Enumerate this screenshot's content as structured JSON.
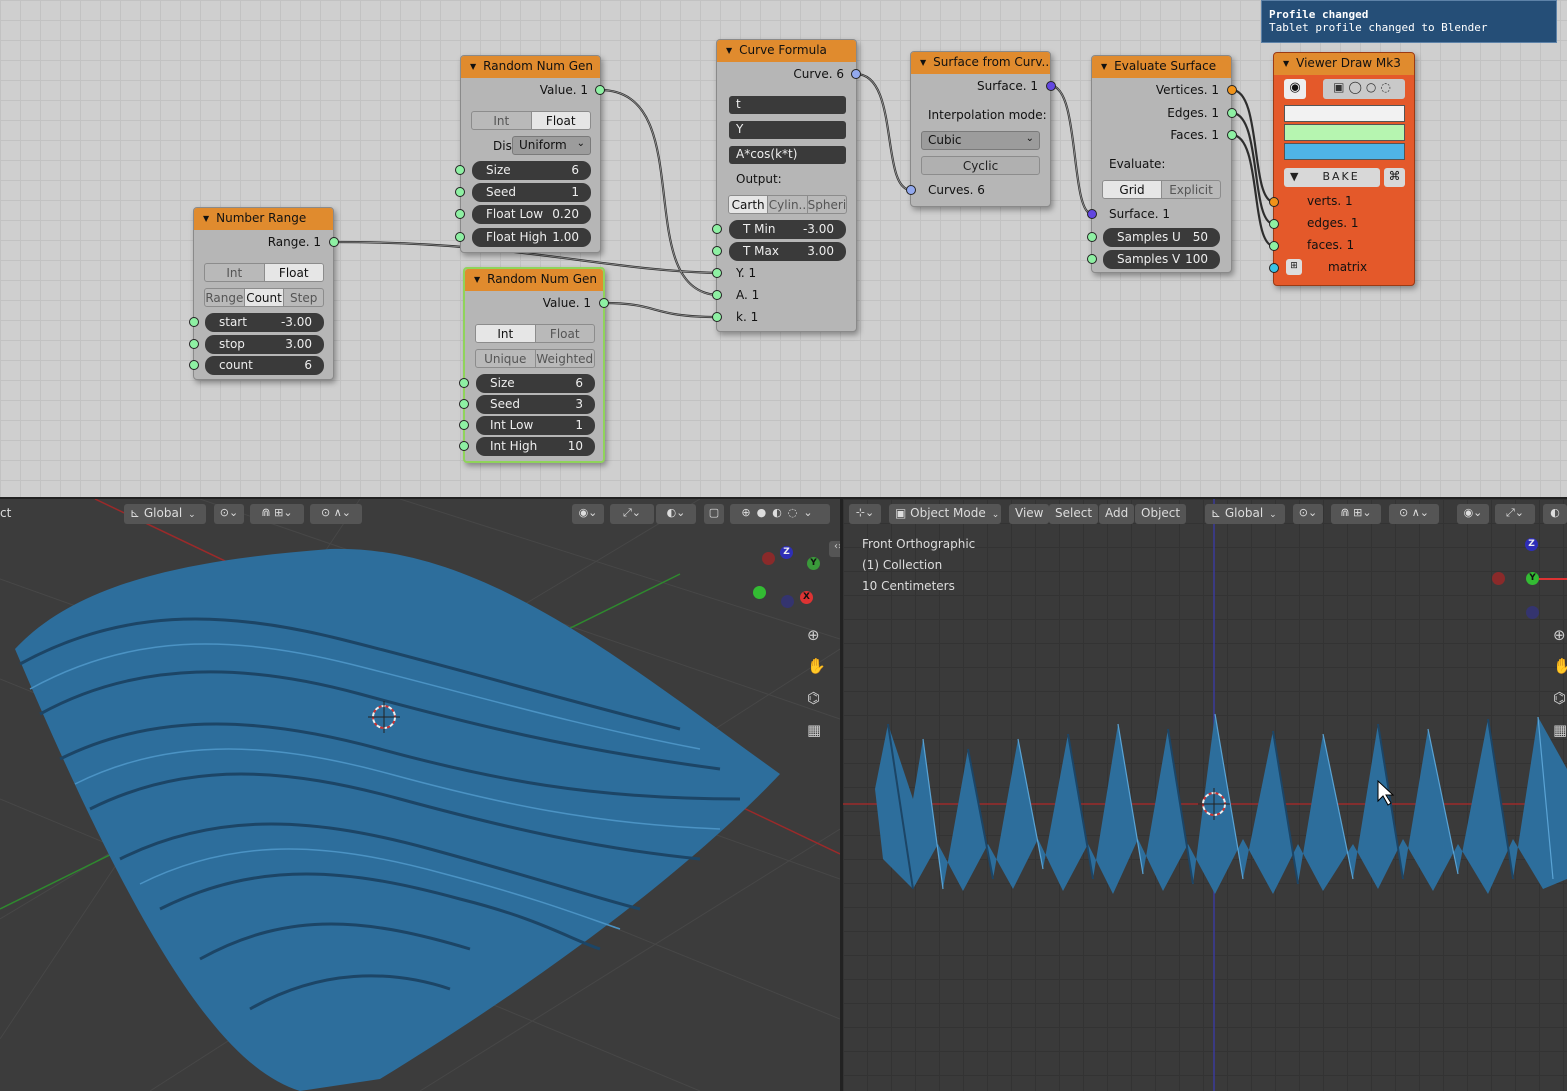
{
  "toast": {
    "title": "Profile changed",
    "message": "Tablet profile changed to Blender"
  },
  "nodes": {
    "number_range": {
      "title": "Number Range",
      "out": "Range. 1",
      "mode": [
        "Int",
        "Float"
      ],
      "mode_active": "Float",
      "submode": [
        "Range",
        "Count",
        "Step"
      ],
      "submode_active": "Count",
      "fields": [
        {
          "label": "start",
          "value": "-3.00"
        },
        {
          "label": "stop",
          "value": "3.00"
        },
        {
          "label": "count",
          "value": "6"
        }
      ]
    },
    "rng1": {
      "title": "Random Num Gen",
      "out": "Value. 1",
      "mode": [
        "Int",
        "Float"
      ],
      "mode_active": "Float",
      "distri_label": "Distri",
      "distri_value": "Uniform",
      "fields": [
        {
          "label": "Size",
          "value": "6"
        },
        {
          "label": "Seed",
          "value": "1"
        },
        {
          "label": "Float Low",
          "value": "0.20"
        },
        {
          "label": "Float High",
          "value": "1.00"
        }
      ]
    },
    "rng2": {
      "title": "Random Num Gen",
      "out": "Value. 1",
      "mode": [
        "Int",
        "Float"
      ],
      "mode_active": "Int",
      "submode": [
        "Unique",
        "Weighted"
      ],
      "fields": [
        {
          "label": "Size",
          "value": "6"
        },
        {
          "label": "Seed",
          "value": "3"
        },
        {
          "label": "Int Low",
          "value": "1"
        },
        {
          "label": "Int High",
          "value": "10"
        }
      ]
    },
    "curve_formula": {
      "title": "Curve Formula",
      "out": "Curve. 6",
      "formulas": [
        "t",
        "Y",
        "A*cos(k*t)"
      ],
      "output_label": "Output:",
      "coords": [
        "Carth",
        "Cylin..",
        "Spheri"
      ],
      "coords_active": "Carth",
      "fields": [
        {
          "label": "T Min",
          "value": "-3.00"
        },
        {
          "label": "T Max",
          "value": "3.00"
        }
      ],
      "inputs": [
        "Y. 1",
        "A. 1",
        "k. 1"
      ]
    },
    "surface_from_curves": {
      "title": "Surface from Curv..",
      "out": "Surface. 1",
      "interp_label": "Interpolation mode:",
      "interp_value": "Cubic",
      "cyclic": "Cyclic",
      "in": "Curves. 6"
    },
    "evaluate_surface": {
      "title": "Evaluate Surface",
      "outs": [
        "Vertices. 1",
        "Edges. 1",
        "Faces. 1"
      ],
      "evaluate_label": "Evaluate:",
      "eval_modes": [
        "Grid",
        "Explicit"
      ],
      "eval_active": "Grid",
      "in": "Surface. 1",
      "fields": [
        {
          "label": "Samples U",
          "value": "50"
        },
        {
          "label": "Samples V",
          "value": "100"
        }
      ]
    },
    "viewer": {
      "title": "Viewer Draw Mk3",
      "bake": "BAKE",
      "inputs": [
        "verts. 1",
        "edges. 1",
        "faces. 1",
        "matrix"
      ],
      "colors": [
        "#f2f2f2",
        "#b6f5b0",
        "#4fb4e6"
      ]
    }
  },
  "viewport_left": {
    "transform": "Global",
    "left_cut": "ct"
  },
  "viewport_right": {
    "mode": "Object Mode",
    "menus": [
      "View",
      "Select",
      "Add",
      "Object"
    ],
    "transform": "Global",
    "overlay": [
      "Front Orthographic",
      "(1) Collection",
      "10 Centimeters"
    ]
  },
  "colors": {
    "node_header": "#e08b2e",
    "viewer_body": "#e4592a",
    "mesh": "#2d6e9c",
    "toast_bg": "#254e77"
  },
  "icons": [
    "eye-icon",
    "zoom-icon",
    "hand-icon",
    "camera-icon",
    "grid-icon",
    "cursor-3d-icon",
    "bake-icon"
  ]
}
